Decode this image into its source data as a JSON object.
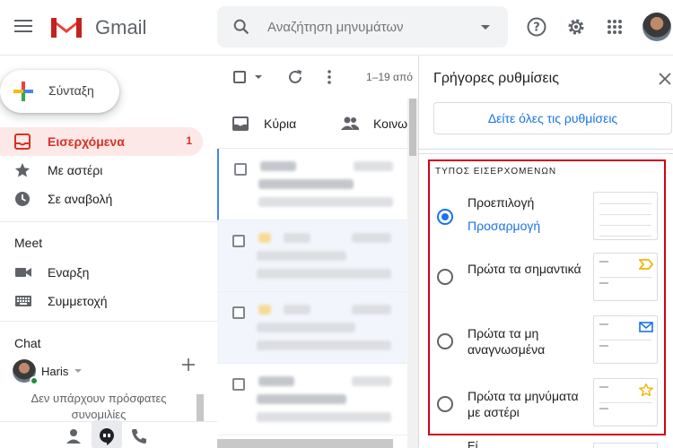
{
  "header": {
    "app_name": "Gmail",
    "search_placeholder": "Αναζήτηση μηνυμάτων"
  },
  "compose": {
    "label": "Σύνταξη"
  },
  "nav": {
    "items": [
      {
        "label": "Εισερχόμενα",
        "count": "1",
        "icon": "inbox-icon",
        "active": true
      },
      {
        "label": "Με αστέρι",
        "icon": "star-icon"
      },
      {
        "label": "Σε αναβολή",
        "icon": "clock-icon"
      }
    ]
  },
  "meet": {
    "title": "Meet",
    "items": [
      {
        "label": "Εναρξη",
        "icon": "video-icon"
      },
      {
        "label": "Συμμετοχή",
        "icon": "keyboard-icon"
      }
    ]
  },
  "chat": {
    "title": "Chat",
    "user": "Haris",
    "empty_text": "Δεν υπάρχουν πρόσφατες συνομιλίες"
  },
  "list": {
    "pagination": "1–19 από",
    "tabs": [
      {
        "label": "Κύρια",
        "icon": "inbox-icon"
      },
      {
        "label": "Κοινω",
        "icon": "people-icon"
      }
    ]
  },
  "quick_settings": {
    "title": "Γρήγορες ρυθμίσεις",
    "all_settings_button": "Δείτε όλες τις ρυθμίσεις",
    "inbox_type": {
      "title": "ΤΥΠΟΣ ΕΙΣΕΡΧΟΜΕΝΩΝ",
      "options": [
        {
          "label": "Προεπιλογή",
          "link": "Προσαρμογή",
          "selected": true
        },
        {
          "label": "Πρώτα τα σημαντικά",
          "selected": false,
          "icon": "important-icon"
        },
        {
          "label": "Πρώτα τα μη αναγνωσμένα",
          "selected": false,
          "icon": "mail-icon"
        },
        {
          "label": "Πρώτα τα μηνύματα με αστέρι",
          "selected": false,
          "icon": "star-icon"
        }
      ]
    },
    "next_label": "Εί..."
  },
  "colors": {
    "accent": "#1a73e8",
    "inbox_active": "#d93025",
    "highlight_border": "#d0021b",
    "important": "#f4b400",
    "mail_icon": "#1a73e8"
  }
}
